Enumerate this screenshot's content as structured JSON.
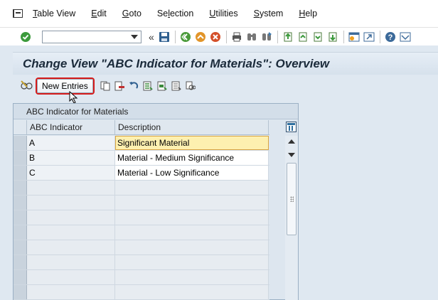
{
  "menubar": {
    "items": [
      {
        "pre": "",
        "u": "T",
        "post": "able View"
      },
      {
        "pre": "",
        "u": "E",
        "post": "dit"
      },
      {
        "pre": "",
        "u": "G",
        "post": "oto"
      },
      {
        "pre": "Se",
        "u": "l",
        "post": "ection"
      },
      {
        "pre": "",
        "u": "U",
        "post": "tilities"
      },
      {
        "pre": "",
        "u": "S",
        "post": "ystem"
      },
      {
        "pre": "",
        "u": "H",
        "post": "elp"
      }
    ]
  },
  "toolbar": {
    "command_field_value": "",
    "nav_glyph": "«",
    "icons": [
      "enter-icon",
      "save-icon",
      "back-icon",
      "exit-icon",
      "cancel-icon",
      "print-icon",
      "find-icon",
      "find-next-icon",
      "first-page-icon",
      "previous-page-icon",
      "next-page-icon",
      "last-page-icon",
      "create-session-icon",
      "shortcut-icon",
      "help-icon",
      "customize-layout-icon"
    ]
  },
  "title": "Change View \"ABC Indicator for Materials\": Overview",
  "app_toolbar": {
    "new_entries_label": "New Entries",
    "icons": [
      "display-change-icon",
      "copy-as-icon",
      "delete-icon",
      "undo-change-icon",
      "select-all-icon",
      "select-block-icon",
      "deselect-all-icon",
      "variant-icon"
    ]
  },
  "table": {
    "caption": "ABC Indicator for Materials",
    "columns": [
      "ABC Indicator",
      "Description"
    ],
    "rows": [
      {
        "abc": "A",
        "desc": "Significant Material",
        "focused": true
      },
      {
        "abc": "B",
        "desc": "Material - Medium Significance",
        "focused": false
      },
      {
        "abc": "C",
        "desc": "Material - Low Significance",
        "focused": false
      }
    ],
    "empty_row_count": 8
  },
  "colors": {
    "highlight_red": "#d61b1b",
    "focus_yellow": "#fdf0b0",
    "title_text": "#1a2a3a"
  }
}
